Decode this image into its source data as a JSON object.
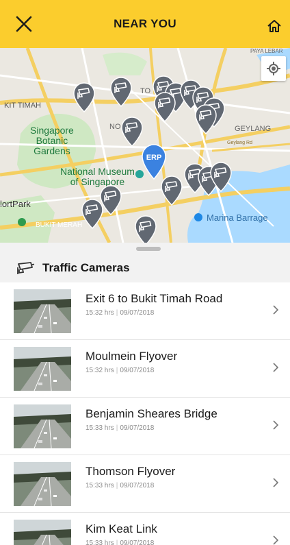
{
  "header": {
    "title": "NEAR YOU",
    "close_icon": "close-icon",
    "home_icon": "home-icon"
  },
  "map": {
    "labels": {
      "kit_timah": "KIT TIMAH",
      "botanic": "Singapore\nBotanic\nGardens",
      "museum": "National Museum\nof Singapore",
      "geylang": "GEYLANG",
      "geylang_rd": "Geylang Rd",
      "fortpark": "lortPark",
      "bukit_merah": "BUKIT MERAH",
      "marina": "Marina Barrage",
      "paya_lebar": "PAYA LEBAR",
      "to": "TO",
      "no": "NO"
    },
    "erp_label": "ERP",
    "locate_icon": "my-location-icon",
    "camera_pin_icon": "camera-pin-icon"
  },
  "section": {
    "title": "Traffic Cameras",
    "icon": "cctv-camera-icon"
  },
  "cameras": [
    {
      "name": "Exit 6 to Bukit Timah Road",
      "time": "15:32 hrs",
      "date": "09/07/2018"
    },
    {
      "name": "Moulmein Flyover",
      "time": "15:32 hrs",
      "date": "09/07/2018"
    },
    {
      "name": "Benjamin Sheares Bridge",
      "time": "15:33 hrs",
      "date": "09/07/2018"
    },
    {
      "name": "Thomson Flyover",
      "time": "15:33 hrs",
      "date": "09/07/2018"
    },
    {
      "name": "Kim Keat Link",
      "time": "15:33 hrs",
      "date": "09/07/2018"
    }
  ],
  "colors": {
    "header_bg": "#fbcd2d",
    "erp_pin": "#3b82e0",
    "camera_pin": "#616872",
    "park": "#c8e6b8",
    "water": "#aadaff",
    "road": "#f7d36b"
  }
}
